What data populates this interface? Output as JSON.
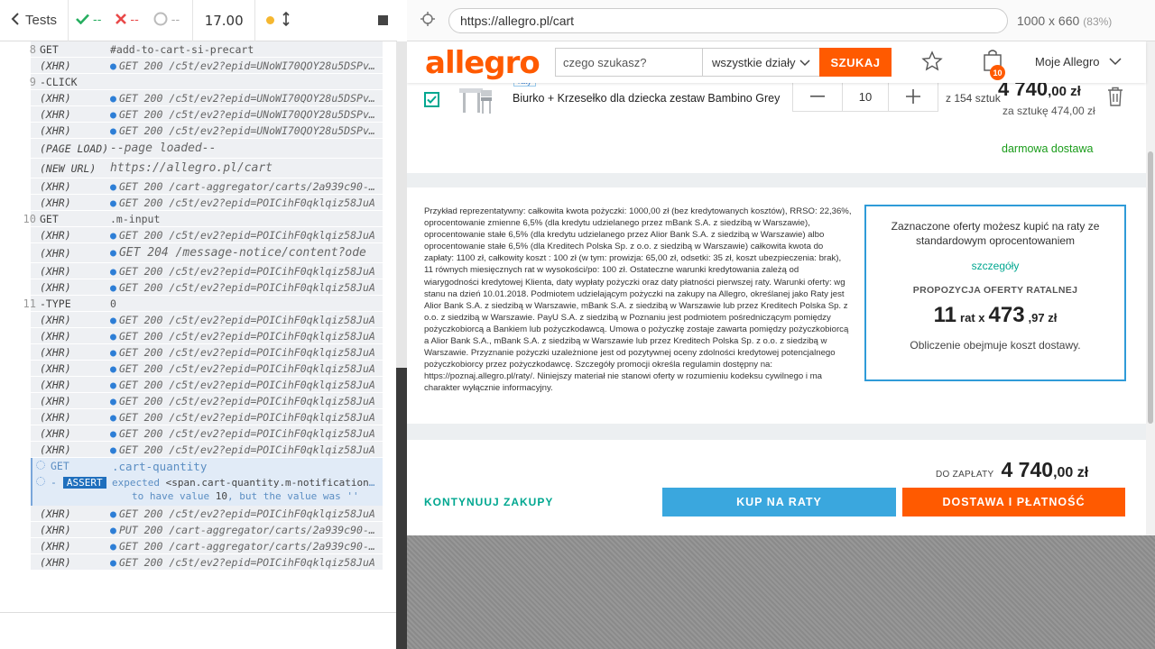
{
  "reporter": {
    "tests_label": "Tests",
    "passed": "--",
    "failed": "--",
    "pending": "--",
    "duration": "17.00",
    "rows_top": [
      {
        "num": "8",
        "cmd": "GET",
        "msg": "#add-to-cart-si-precart",
        "kind": "plain"
      },
      {
        "num": "",
        "cmd": "(XHR)",
        "msg": "GET 200 /c5t/ev2?epid=UNoWI70QOY28u5DSPvXr",
        "kind": "xhr"
      },
      {
        "num": "9",
        "cmd": "-CLICK",
        "msg": "",
        "kind": "plain"
      },
      {
        "num": "",
        "cmd": "(XHR)",
        "msg": "GET 200 /c5t/ev2?epid=UNoWI70QOY28u5DSPvXr",
        "kind": "xhr"
      },
      {
        "num": "",
        "cmd": "(XHR)",
        "msg": "GET 200 /c5t/ev2?epid=UNoWI70QOY28u5DSPvXr",
        "kind": "xhr"
      },
      {
        "num": "",
        "cmd": "(XHR)",
        "msg": "GET 200 /c5t/ev2?epid=UNoWI70QOY28u5DSPvXr",
        "kind": "xhr"
      },
      {
        "num": "",
        "cmd": "(PAGE LOAD)",
        "msg": "--page loaded--",
        "kind": "page"
      },
      {
        "num": "",
        "cmd": "(NEW URL)",
        "msg": "https://allegro.pl/cart",
        "kind": "page"
      },
      {
        "num": "",
        "cmd": "(XHR)",
        "msg": "GET 200 /cart-aggregator/carts/2a939c90-ab12",
        "kind": "xhr"
      },
      {
        "num": "",
        "cmd": "(XHR)",
        "msg": "GET 200 /c5t/ev2?epid=POICihF0qklqiz58JuA",
        "kind": "xhr"
      },
      {
        "num": "10",
        "cmd": "GET",
        "msg": ".m-input",
        "kind": "plain"
      },
      {
        "num": "",
        "cmd": "(XHR)",
        "msg": "GET 200 /c5t/ev2?epid=POICihF0qklqiz58JuA",
        "kind": "xhr"
      },
      {
        "num": "",
        "cmd": "(XHR)",
        "msg": "GET 204 /message-notice/content?ode",
        "kind": "xhrbig"
      },
      {
        "num": "",
        "cmd": "(XHR)",
        "msg": "GET 200 /c5t/ev2?epid=POICihF0qklqiz58JuA",
        "kind": "xhr"
      },
      {
        "num": "",
        "cmd": "(XHR)",
        "msg": "GET 200 /c5t/ev2?epid=POICihF0qklqiz58JuA",
        "kind": "xhr"
      },
      {
        "num": "11",
        "cmd": "-TYPE",
        "msg": "0",
        "kind": "plain"
      },
      {
        "num": "",
        "cmd": "(XHR)",
        "msg": "GET 200 /c5t/ev2?epid=POICihF0qklqiz58JuA",
        "kind": "xhr"
      },
      {
        "num": "",
        "cmd": "(XHR)",
        "msg": "GET 200 /c5t/ev2?epid=POICihF0qklqiz58JuA",
        "kind": "xhr"
      },
      {
        "num": "",
        "cmd": "(XHR)",
        "msg": "GET 200 /c5t/ev2?epid=POICihF0qklqiz58JuA",
        "kind": "xhr"
      },
      {
        "num": "",
        "cmd": "(XHR)",
        "msg": "GET 200 /c5t/ev2?epid=POICihF0qklqiz58JuA",
        "kind": "xhr"
      },
      {
        "num": "",
        "cmd": "(XHR)",
        "msg": "GET 200 /c5t/ev2?epid=POICihF0qklqiz58JuA",
        "kind": "xhr"
      },
      {
        "num": "",
        "cmd": "(XHR)",
        "msg": "GET 200 /c5t/ev2?epid=POICihF0qklqiz58JuA",
        "kind": "xhr"
      },
      {
        "num": "",
        "cmd": "(XHR)",
        "msg": "GET 200 /c5t/ev2?epid=POICihF0qklqiz58JuA",
        "kind": "xhr"
      },
      {
        "num": "",
        "cmd": "(XHR)",
        "msg": "GET 200 /c5t/ev2?epid=POICihF0qklqiz58JuA",
        "kind": "xhr"
      },
      {
        "num": "",
        "cmd": "(XHR)",
        "msg": "GET 200 /c5t/ev2?epid=POICihF0qklqiz58JuA",
        "kind": "xhr"
      }
    ],
    "fail": {
      "cmd1": "GET",
      "msg1": ".cart-quantity",
      "assert_label": "ASSERT",
      "assert_prefix": "expected",
      "assert_code": "<span.cart-quantity.m-notification.m-notification--icon>",
      "assert_mid": "to have value",
      "assert_value": "10",
      "assert_tail": ", but the value was ''"
    },
    "rows_bottom": [
      {
        "num": "",
        "cmd": "(XHR)",
        "msg": "GET 200 /c5t/ev2?epid=POICihF0qklqiz58JuA",
        "kind": "xhr"
      },
      {
        "num": "",
        "cmd": "(XHR)",
        "msg": "PUT 200 /cart-aggregator/carts/2a939c90-ab12",
        "kind": "xhr"
      },
      {
        "num": "",
        "cmd": "(XHR)",
        "msg": "GET 200 /cart-aggregator/carts/2a939c90-ab12",
        "kind": "xhr"
      },
      {
        "num": "",
        "cmd": "(XHR)",
        "msg": "GET 200 /c5t/ev2?epid=POICihF0qklqiz58JuA",
        "kind": "xhr"
      }
    ]
  },
  "aut": {
    "url": "https://allegro.pl/cart",
    "viewport": "1000 x 660",
    "zoom": "(83%)"
  },
  "site": {
    "logo": "allegro",
    "search_placeholder": "czego szukasz?",
    "department": "wszystkie działy",
    "search_button": "SZUKAJ",
    "cart_count": "10",
    "account": "Moje Allegro",
    "item": {
      "tag": "raty",
      "name": "Biurko + Krzesełko dla dziecka zestaw Bambino Grey",
      "quantity": "10",
      "stock": "z 154 sztuk",
      "price_main": "4 740",
      "price_cents": ",00 zł",
      "unit_price": "za sztukę 474,00 zł",
      "shipping": "darmowa dostawa"
    },
    "loan_text": "Przykład reprezentatywny: całkowita kwota pożyczki: 1000,00 zł (bez kredytowanych kosztów), RRSO: 22,36%, oprocentowanie zmienne 6,5% (dla kredytu udzielanego przez mBank S.A. z siedzibą w Warszawie), oprocentowanie stałe 6,5% (dla kredytu udzielanego przez Alior Bank S.A. z siedzibą w Warszawie) albo oprocentowanie stałe 6,5% (dla Kreditech Polska Sp. z o.o. z siedzibą w Warszawie) całkowita kwota do zapłaty: 1100 zł, całkowity koszt : 100 zł (w tym: prowizja: 65,00 zł, odsetki: 35 zł, koszt ubezpieczenia: brak), 11 równych miesięcznych rat w wysokości/po: 100 zł. Ostateczne warunki kredytowania zależą od wiarygodności kredytowej Klienta, daty wypłaty pożyczki oraz daty płatności pierwszej raty. Warunki oferty: wg stanu na dzień 10.01.2018. Podmiotem udzielającym pożyczki na zakupy na Allegro, określanej jako Raty jest Alior Bank S.A. z siedzibą w Warszawie, mBank S.A. z siedzibą w Warszawie lub przez Kreditech Polska Sp. z o.o. z siedzibą w Warszawie. PayU S.A. z siedzibą w Poznaniu jest podmiotem pośredniczącym pomiędzy pożyczkobiorcą a Bankiem lub pożyczkodawcą. Umowa o pożyczkę zostaje zawarta pomiędzy pożyczkobiorcą a Alior Bank S.A., mBank S.A. z siedzibą w Warszawie lub przez Kreditech Polska Sp. z o.o. z siedzibą w Warszawie. Przyznanie pożyczki uzależnione jest od pozytywnej oceny zdolności kredytowej potencjalnego pożyczkobiorcy przez pożyczkodawcę. Szczegóły promocji określa regulamin dostępny na: https://poznaj.allegro.pl/raty/. Niniejszy materiał nie stanowi oferty w rozumieniu kodeksu cywilnego i ma charakter wyłącznie informacyjny.",
    "loan_box": {
      "head": "Zaznaczone oferty możesz kupić na raty ze standardowym oprocentowaniem",
      "link": "szczegóły",
      "title": "PROPOZYCJA OFERTY RATALNEJ",
      "count": "11",
      "rate_x": "rat x",
      "amount": "473",
      "amount_cents": ",97 zł",
      "note": "Obliczenie obejmuje koszt dostawy."
    },
    "summary": {
      "to_pay_label": "DO ZAPŁATY",
      "total_main": "4 740",
      "total_cents": ",00 zł",
      "continue": "KONTYNUUJ ZAKUPY",
      "buy_installments": "KUP NA RATY",
      "checkout": "DOSTAWA I PŁATNOŚĆ"
    }
  },
  "colors": {
    "brand": "#ff5a00",
    "teal": "#00a790",
    "blue": "#3aa7de"
  }
}
